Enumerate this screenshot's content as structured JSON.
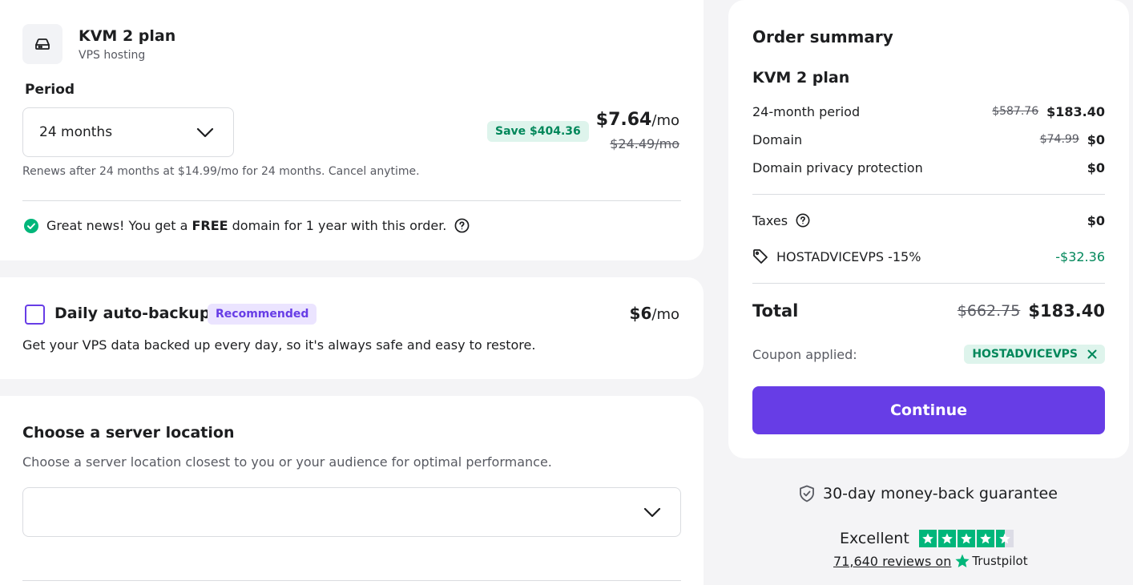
{
  "plan": {
    "title": "KVM 2 plan",
    "subtitle": "VPS hosting",
    "period_label": "Period",
    "period_value": "24 months",
    "save_badge": "Save $404.36",
    "price": "$7.64",
    "price_unit": "/mo",
    "old_price": "$24.49/mo",
    "renews_text": "Renews after 24 months at $14.99/mo for 24 months. Cancel anytime.",
    "free_domain_pre": "Great news! You get a ",
    "free_domain_bold": "FREE",
    "free_domain_post": " domain for 1 year with this order."
  },
  "backup": {
    "title": "Daily auto-backup",
    "badge": "Recommended",
    "price": "$6",
    "price_unit": "/mo",
    "description": "Get your VPS data backed up every day, so it's always safe and easy to restore.",
    "checked": false
  },
  "location": {
    "title": "Choose a server location",
    "description": "Choose a server location closest to you or your audience for optimal performance.",
    "selected": ""
  },
  "summary": {
    "title": "Order summary",
    "plan_name": "KVM 2 plan",
    "lines": [
      {
        "label": "24-month period",
        "old": "$587.76",
        "value": "$183.40"
      },
      {
        "label": "Domain",
        "old": "$74.99",
        "value": "$0"
      },
      {
        "label": "Domain privacy protection",
        "old": "",
        "value": "$0"
      }
    ],
    "taxes_label": "Taxes",
    "taxes_value": "$0",
    "discount_label": "HOSTADVICEVPS -15%",
    "discount_value": "-$32.36",
    "total_label": "Total",
    "total_old": "$662.75",
    "total_value": "$183.40",
    "coupon_label": "Coupon applied:",
    "coupon_code": "HOSTADVICEVPS",
    "continue_label": "Continue"
  },
  "guarantee": "30-day money-back guarantee",
  "trustpilot": {
    "rating_word": "Excellent",
    "rating_stars": 4.5,
    "reviews_text": "71,640 reviews on",
    "brand": "Trustpilot"
  },
  "colors": {
    "accent": "#673de6",
    "success": "#00875a",
    "success_bg": "#def4ec",
    "trustpilot_green": "#00b67a"
  }
}
